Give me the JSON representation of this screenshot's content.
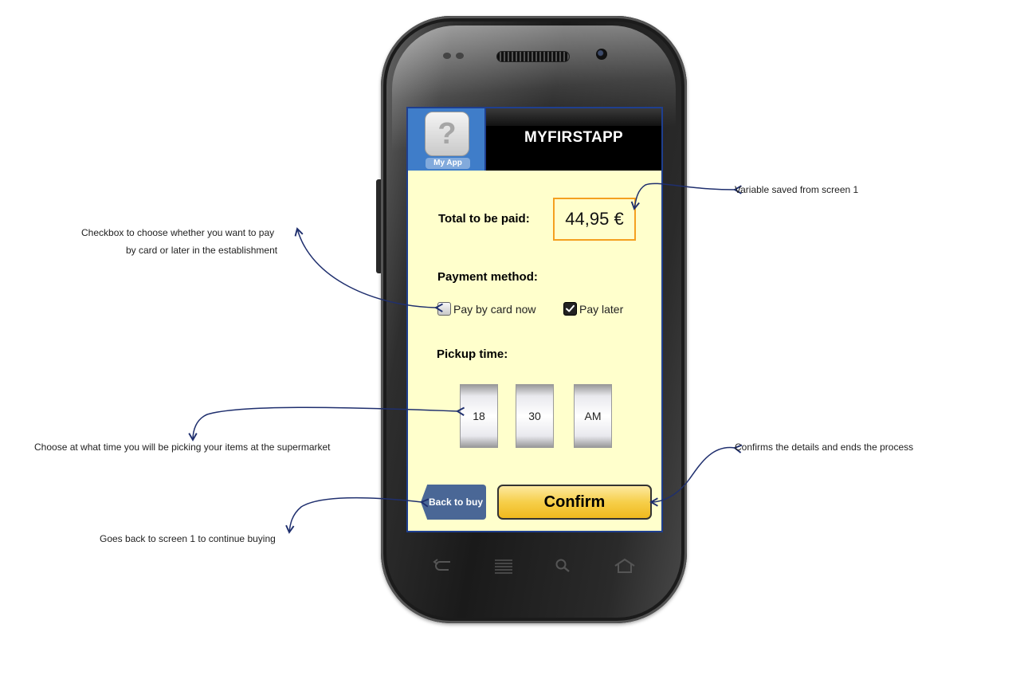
{
  "app": {
    "icon_label": "My App",
    "icon_glyph": "?",
    "title": "MYFIRSTAPP"
  },
  "payment": {
    "total_label": "Total to be paid:",
    "total_value": "44,95 €",
    "method_label": "Payment method:",
    "options": [
      {
        "label": "Pay by card now",
        "checked": false
      },
      {
        "label": "Pay later",
        "checked": true
      }
    ]
  },
  "pickup": {
    "label": "Pickup time:",
    "hour": "18",
    "minute": "30",
    "period": "AM"
  },
  "buttons": {
    "back": "Back to buy",
    "confirm": "Confirm"
  },
  "annotations": {
    "variable": "Variable saved from screen 1",
    "checkbox_line1": "Checkbox to choose whether you want to pay",
    "checkbox_line2": "by card or later in the establishment",
    "time": "Choose at what time you will be picking your items at the supermarket",
    "confirm": "Confirms the details and ends the process",
    "back": "Goes back to screen 1 to continue buying"
  },
  "colors": {
    "screen_bg": "#ffffcc",
    "accent_blue": "#1f3f8f",
    "amount_border": "#f4a020",
    "confirm_yellow": "#f6cf4a",
    "back_button": "#4a6796",
    "arrow": "#1f2f6e"
  }
}
